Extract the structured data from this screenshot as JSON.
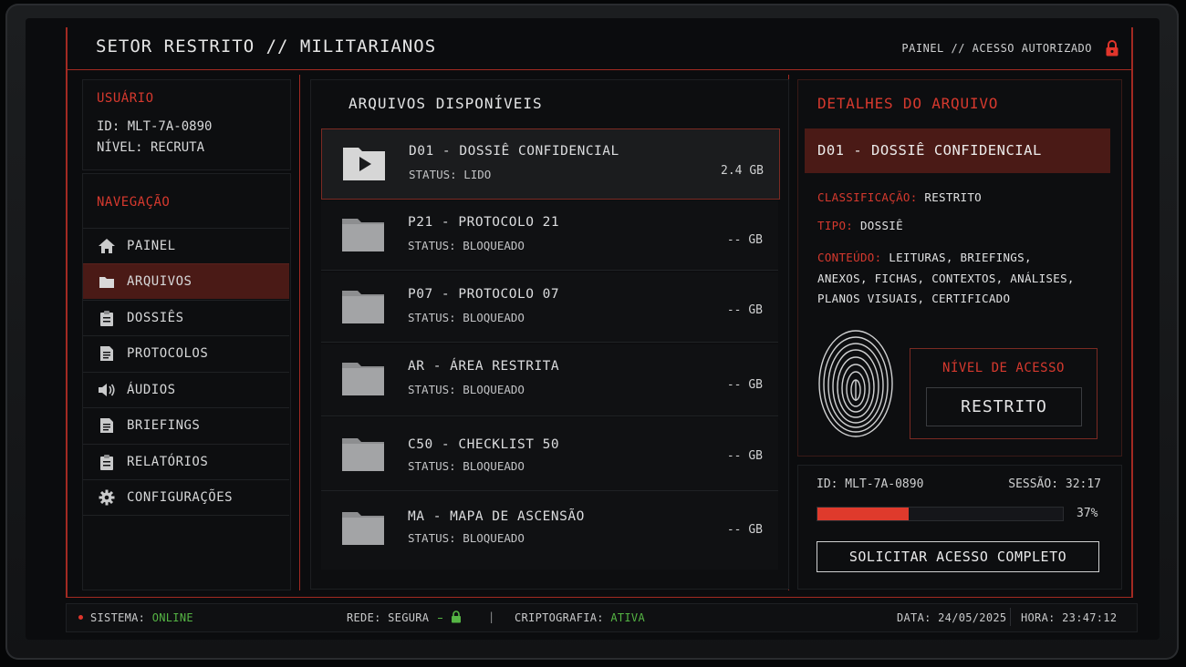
{
  "header": {
    "title": "SETOR RESTRITO // MILITARIANOS",
    "breadcrumb": "PAINEL // ACESSO AUTORIZADO"
  },
  "user": {
    "section_label": "USUÁRIO",
    "id_line": "ID: MLT-7A-0890",
    "level_line": "NÍVEL: RECRUTA"
  },
  "nav": {
    "section_label": "NAVEGAÇÃO",
    "items": [
      {
        "label": "PAINEL",
        "icon": "home-icon"
      },
      {
        "label": "ARQUIVOS",
        "icon": "folder-icon",
        "active": true
      },
      {
        "label": "DOSSIÊS",
        "icon": "clipboard-icon"
      },
      {
        "label": "PROTOCOLOS",
        "icon": "document-icon"
      },
      {
        "label": "ÁUDIOS",
        "icon": "speaker-icon"
      },
      {
        "label": "BRIEFINGS",
        "icon": "document-icon"
      },
      {
        "label": "RELATÓRIOS",
        "icon": "clipboard-icon"
      },
      {
        "label": "CONFIGURAÇÕES",
        "icon": "gear-icon"
      }
    ]
  },
  "files": {
    "title": "ARQUIVOS DISPONÍVEIS",
    "items": [
      {
        "name": "D01 - DOSSIÊ CONFIDENCIAL",
        "status": "STATUS: LIDO",
        "size": "2.4 GB",
        "icon": "play-folder-icon"
      },
      {
        "name": "P21 - PROTOCOLO 21",
        "status": "STATUS: BLOQUEADO",
        "size": "-- GB",
        "icon": "folder-icon"
      },
      {
        "name": "P07 - PROTOCOLO 07",
        "status": "STATUS: BLOQUEADO",
        "size": "-- GB",
        "icon": "folder-icon"
      },
      {
        "name": "AR - ÁREA RESTRITA",
        "status": "STATUS: BLOQUEADO",
        "size": "-- GB",
        "icon": "folder-icon"
      },
      {
        "name": "C50 - CHECKLIST 50",
        "status": "STATUS: BLOQUEADO",
        "size": "-- GB",
        "icon": "folder-icon"
      },
      {
        "name": "MA - MAPA DE ASCENSÃO",
        "status": "STATUS: BLOQUEADO",
        "size": "-- GB",
        "icon": "folder-icon"
      }
    ]
  },
  "details": {
    "title": "DETALHES DO ARQUIVO",
    "selected_name": "D01 - DOSSIÊ CONFIDENCIAL",
    "classification_label": "CLASSIFICAÇÃO:",
    "classification_value": "RESTRITO",
    "type_label": "TIPO:",
    "type_value": "DOSSIÊ",
    "content_label": "CONTEÚDO:",
    "content_line1": "LEITURAS, BRIEFINGS,",
    "content_line2": "ANEXOS, FICHAS, CONTEXTOS, ANÁLISES,",
    "content_line3": "PLANOS VISUAIS, CERTIFICADO",
    "access_label": "NÍVEL DE ACESSO",
    "access_value": "RESTRITO"
  },
  "session": {
    "id_line": "ID: MLT-7A-0890",
    "session_line": "SESSÃO: 32:17",
    "progress_percent": 37,
    "progress_text": "37%",
    "button_label": "SOLICITAR ACESSO COMPLETO"
  },
  "status_bar": {
    "system_label": "SISTEMA:",
    "system_value": "ONLINE",
    "network_label": "REDE: SEGURA",
    "separator": "|",
    "crypto_label": "CRIPTOGRAFIA:",
    "crypto_value": "ATIVA",
    "date": "DATA: 24/05/2025",
    "time": "HORA: 23:47:12"
  },
  "colors": {
    "accent": "#d6392e",
    "active_bg": "#4a1a16",
    "online": "#55b544"
  }
}
